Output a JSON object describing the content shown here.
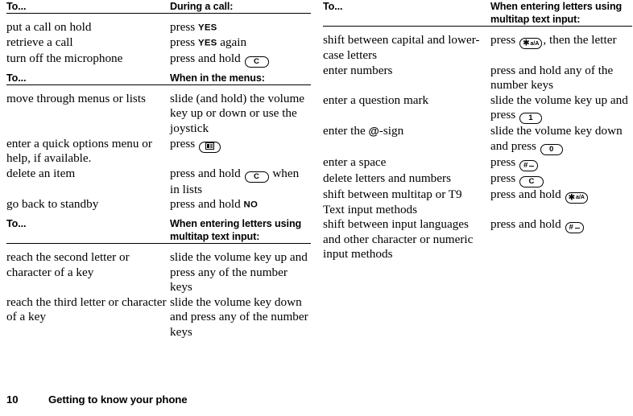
{
  "page": {
    "number": "10",
    "running_head": "Getting to know your phone"
  },
  "keys": {
    "clear": {
      "label": "C",
      "name": "clear-key"
    },
    "menu": {
      "label": "",
      "name": "menu-key"
    },
    "star": {
      "glyph": "✱",
      "sub": "a/A",
      "name": "star-key"
    },
    "hash": {
      "glyph": "#",
      "sub": "—",
      "name": "hash-key"
    },
    "one": {
      "label": "1",
      "name": "number-key-1"
    },
    "zero": {
      "label": "0",
      "name": "number-key-0"
    }
  },
  "left_column": {
    "blocks": [
      {
        "header": {
          "col1": "To...",
          "col2": "During a call:"
        },
        "rows": [
          {
            "col1": "put a call on hold",
            "col2_pre": "press ",
            "col2_caps": "YES",
            "col2_post": ""
          },
          {
            "col1": "retrieve a call",
            "col2_pre": "press ",
            "col2_caps": "YES",
            "col2_post": " again"
          },
          {
            "col1": "turn off the microphone",
            "col2_pre": "press and hold ",
            "col2_key": "clear",
            "col2_post": ""
          }
        ]
      },
      {
        "header": {
          "col1": "To...",
          "col2": "When in the menus:"
        },
        "rows": [
          {
            "col1": "move through menus or lists",
            "col2_pre": "slide (and hold) the volume key up or down or use the joystick"
          },
          {
            "col1": "enter a quick options menu or help, if available.",
            "col2_pre": "press ",
            "col2_key": "menu",
            "col2_post": ""
          },
          {
            "col1": "delete an item",
            "col2_pre": "press and hold ",
            "col2_key": "clear",
            "col2_post": " when in lists"
          },
          {
            "col1": "go back to standby",
            "col2_pre": "press and hold ",
            "col2_caps": "NO",
            "col2_post": ""
          }
        ]
      },
      {
        "header": {
          "col1": "To...",
          "col2": "When entering letters using multitap text input:"
        },
        "rows": [
          {
            "col1": "reach the second letter or character of a key",
            "col2_pre": "slide the volume key up and press any of the number keys"
          },
          {
            "col1": "reach the third letter or character of a key",
            "col2_pre": "slide the volume key down and press any of the number keys"
          }
        ]
      }
    ]
  },
  "right_column": {
    "blocks": [
      {
        "header": {
          "col1": "To...",
          "col2": "When entering letters using multitap text input:"
        },
        "rows": [
          {
            "col1": "shift between capital and lower-case letters",
            "col2_pre": "press ",
            "col2_key": "star",
            "col2_post": ", then the letter"
          },
          {
            "col1": "enter numbers",
            "col2_pre": "press and hold any of the number keys"
          },
          {
            "col1": "enter a question mark",
            "col2_pre": "slide the volume key up and press ",
            "col2_key": "one",
            "col2_post": ""
          },
          {
            "col1_pre": "enter the ",
            "col1_at": "@",
            "col1_post": "-sign",
            "col2_pre": "slide the volume key down and press ",
            "col2_key": "zero",
            "col2_post": ""
          },
          {
            "col1": "enter a space",
            "col2_pre": "press ",
            "col2_key": "hash",
            "col2_post": ""
          },
          {
            "col1": "delete letters and numbers",
            "col2_pre": "press ",
            "col2_key": "clear",
            "col2_post": ""
          },
          {
            "col1": "shift between multitap or T9 Text input methods",
            "col2_pre": "press and hold ",
            "col2_key": "star",
            "col2_post": ""
          },
          {
            "col1": "shift between input languages and other character or numeric input methods",
            "col2_pre": "press and hold ",
            "col2_key": "hash",
            "col2_post": ""
          }
        ]
      }
    ]
  }
}
